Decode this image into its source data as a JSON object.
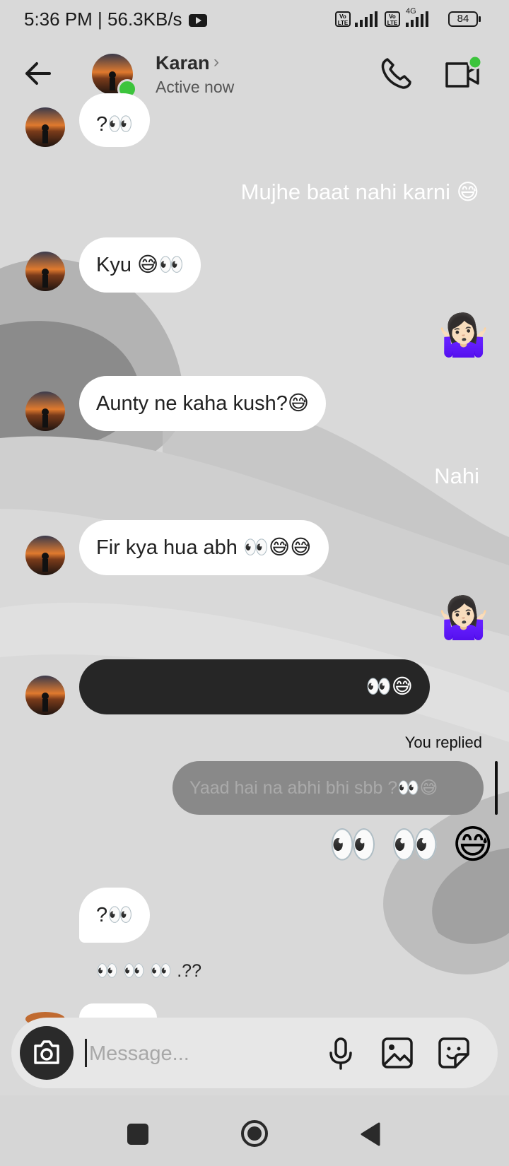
{
  "status_bar": {
    "time_speed": "5:36 PM | 56.3KB/s",
    "volte_1": "Vo LTE",
    "volte_2": "Vo LTE",
    "network": "4G",
    "battery": "84"
  },
  "header": {
    "contact_name": "Karan",
    "status": "Active now",
    "online_color": "#3cc43c"
  },
  "messages": {
    "m1": "?👀",
    "m2_out": "Mujhe baat nahi karni 😅",
    "m3": "Kyu 😅👀",
    "m4_out": "🤷🏻‍♀️",
    "m5": "Aunty ne kaha kush?😅",
    "m6_out": "Nahi",
    "m7": "Fir kya hua abh 👀😅😅",
    "m8_out": "🤷🏻‍♀️",
    "m9": "👀😅",
    "replied_label": "You replied",
    "reply_quote": "Yaad hai na abhi bhi sbb ?👀😅",
    "m10_out": "👀 👀 😅",
    "m11": "?👀",
    "m12": "👀 👀 👀 .??"
  },
  "composer": {
    "placeholder": "Message..."
  },
  "icons": {
    "back": "back-arrow-icon",
    "call": "phone-icon",
    "video": "video-call-icon",
    "camera": "camera-icon",
    "mic": "microphone-icon",
    "gallery": "gallery-icon",
    "sticker": "sticker-icon"
  }
}
